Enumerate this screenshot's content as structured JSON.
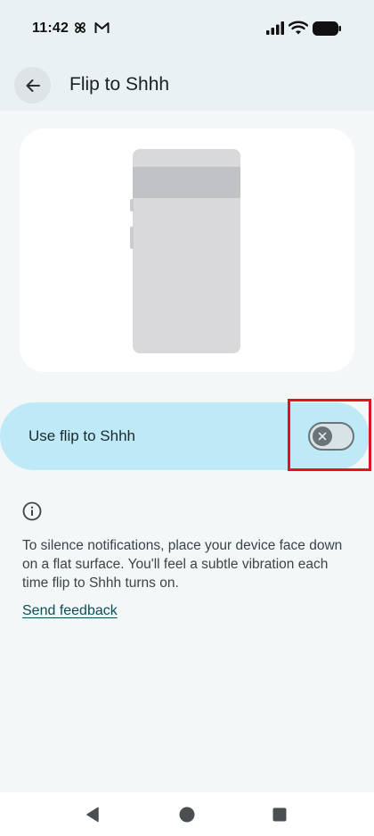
{
  "status_bar": {
    "time": "11:42",
    "left_icons": [
      "pinwheel-icon",
      "gmail-icon"
    ],
    "right_icons": [
      "signal-icon",
      "wifi-icon",
      "battery-icon"
    ]
  },
  "app_bar": {
    "back_icon": "arrow-back-icon",
    "title": "Flip to Shhh"
  },
  "illustration": {
    "icon": "phone-icon"
  },
  "setting": {
    "label": "Use flip to Shhh",
    "enabled": false,
    "thumb_icon": "close-icon"
  },
  "info": {
    "icon": "info-icon",
    "text": "To silence notifications, place your device face down on a flat surface. You'll feel a subtle vibration each time flip to Shhh turns on.",
    "feedback_link": "Send feedback"
  },
  "nav_bar": {
    "icons": [
      "back-triangle-icon",
      "home-circle-icon",
      "overview-square-icon"
    ]
  },
  "colors": {
    "background": "#f3f7f8",
    "toggle_row": "#bdeaf6",
    "link": "#0f4c53",
    "highlight": "#e0141e"
  }
}
